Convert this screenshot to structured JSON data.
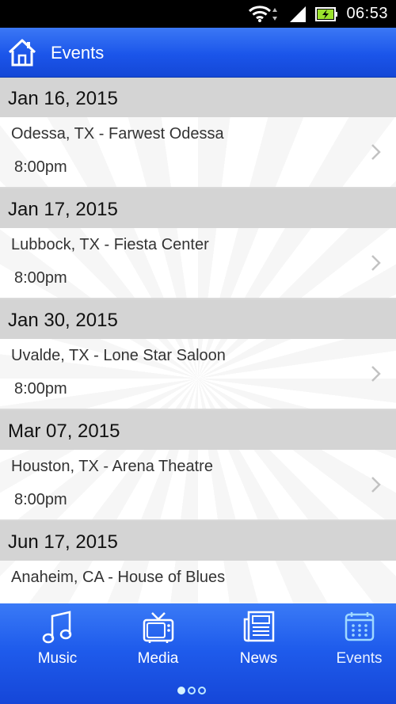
{
  "status_bar": {
    "time": "06:53"
  },
  "header": {
    "title": "Events"
  },
  "events": [
    {
      "date": "Jan 16, 2015",
      "venue": "Odessa, TX - Farwest Odessa",
      "time": "8:00pm"
    },
    {
      "date": "Jan 17, 2015",
      "venue": "Lubbock, TX - Fiesta Center",
      "time": "8:00pm"
    },
    {
      "date": "Jan 30, 2015",
      "venue": "Uvalde, TX - Lone Star Saloon",
      "time": "8:00pm"
    },
    {
      "date": "Mar 07, 2015",
      "venue": "Houston, TX - Arena Theatre",
      "time": "8:00pm"
    },
    {
      "date": "Jun 17, 2015",
      "venue": "Anaheim, CA - House of Blues",
      "time": ""
    }
  ],
  "tabs": [
    {
      "label": "Music",
      "icon": "music-note-icon"
    },
    {
      "label": "Media",
      "icon": "tv-icon"
    },
    {
      "label": "News",
      "icon": "newspaper-icon"
    },
    {
      "label": "Events",
      "icon": "calendar-icon",
      "active": true
    }
  ],
  "pager": {
    "pages": 3,
    "current": 1
  },
  "colors": {
    "accent": "#1b55ea",
    "header_row": "#d4d4d4"
  }
}
